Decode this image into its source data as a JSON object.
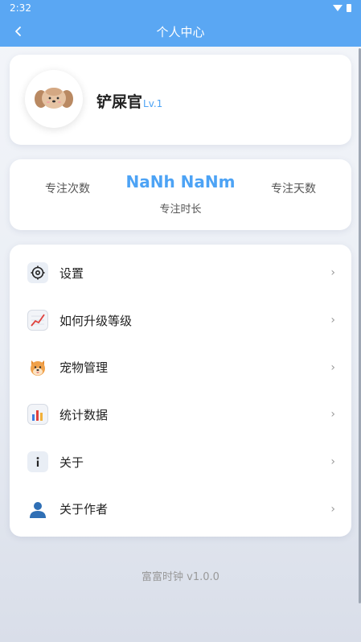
{
  "status_bar": {
    "time": "2:32"
  },
  "header": {
    "title": "个人中心"
  },
  "profile": {
    "name": "铲屎官",
    "level": "Lv.1"
  },
  "stats": {
    "left_label": "专注次数",
    "focus_time_value": "NaNh NaNm",
    "focus_time_label": "专注时长",
    "right_label": "专注天数"
  },
  "menu": {
    "items": [
      {
        "label": "设置",
        "icon": "gear-icon"
      },
      {
        "label": "如何升级等级",
        "icon": "trend-chart-icon"
      },
      {
        "label": "宠物管理",
        "icon": "dog-face-icon"
      },
      {
        "label": "统计数据",
        "icon": "bar-chart-icon"
      },
      {
        "label": "关于",
        "icon": "info-icon"
      },
      {
        "label": "关于作者",
        "icon": "user-icon"
      }
    ],
    "chevron": "›"
  },
  "footer": {
    "version": "富富时钟 v1.0.0"
  },
  "colors": {
    "accent": "#4da3f5",
    "appbar": "#5aa7f3"
  }
}
